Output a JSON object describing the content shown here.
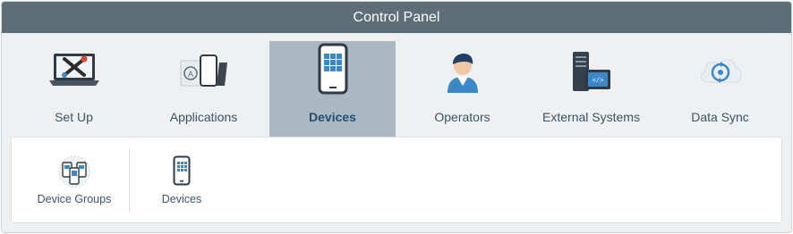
{
  "window": {
    "title": "Control Panel"
  },
  "tabs": [
    {
      "label": "Set Up",
      "icon": "laptop-tools-icon",
      "active": false
    },
    {
      "label": "Applications",
      "icon": "applications-icon",
      "active": false
    },
    {
      "label": "Devices",
      "icon": "device-phone-icon",
      "active": true
    },
    {
      "label": "Operators",
      "icon": "operator-person-icon",
      "active": false
    },
    {
      "label": "External Systems",
      "icon": "server-monitor-icon",
      "active": false
    },
    {
      "label": "Data Sync",
      "icon": "cloud-sync-icon",
      "active": false
    }
  ],
  "subnav": {
    "items": [
      {
        "label": "Device Groups",
        "icon": "device-groups-icon"
      },
      {
        "label": "Devices",
        "icon": "device-phone-small-icon"
      }
    ]
  },
  "colors": {
    "titlebar": "#5e6e79",
    "active_tab": "#a9b8c2",
    "accent_dark": "#24506e",
    "icon_blue": "#3a88c8"
  }
}
